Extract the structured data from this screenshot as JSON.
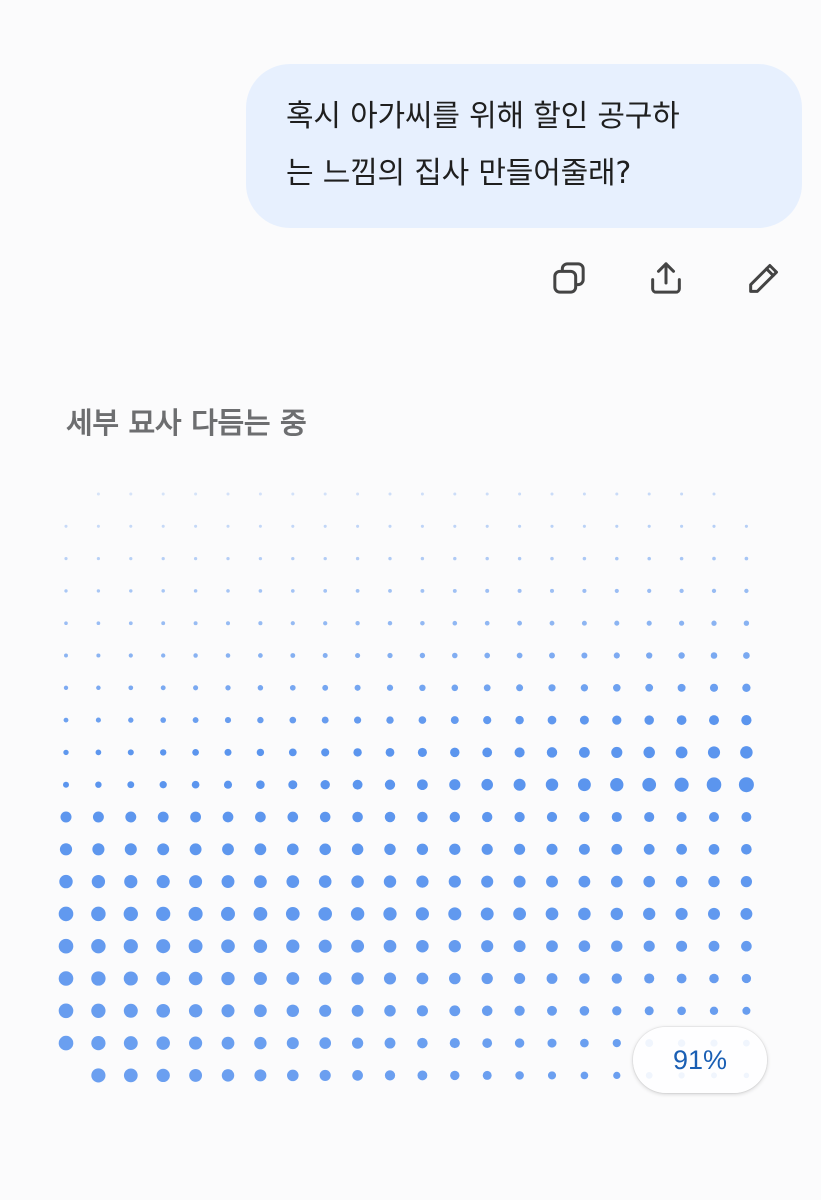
{
  "user_message": {
    "line1": "혹시 아가씨를 위해 할인 공구하",
    "line2": "는 느낌의 집사 만들어줄래?"
  },
  "message_actions": [
    {
      "icon": "copy-icon"
    },
    {
      "icon": "share-icon"
    },
    {
      "icon": "edit-icon"
    }
  ],
  "generation": {
    "status_text": "세부 묘사 다듬는 중",
    "progress_label": "91%",
    "progress": 0.91,
    "accent_color": "#5b95ee"
  }
}
